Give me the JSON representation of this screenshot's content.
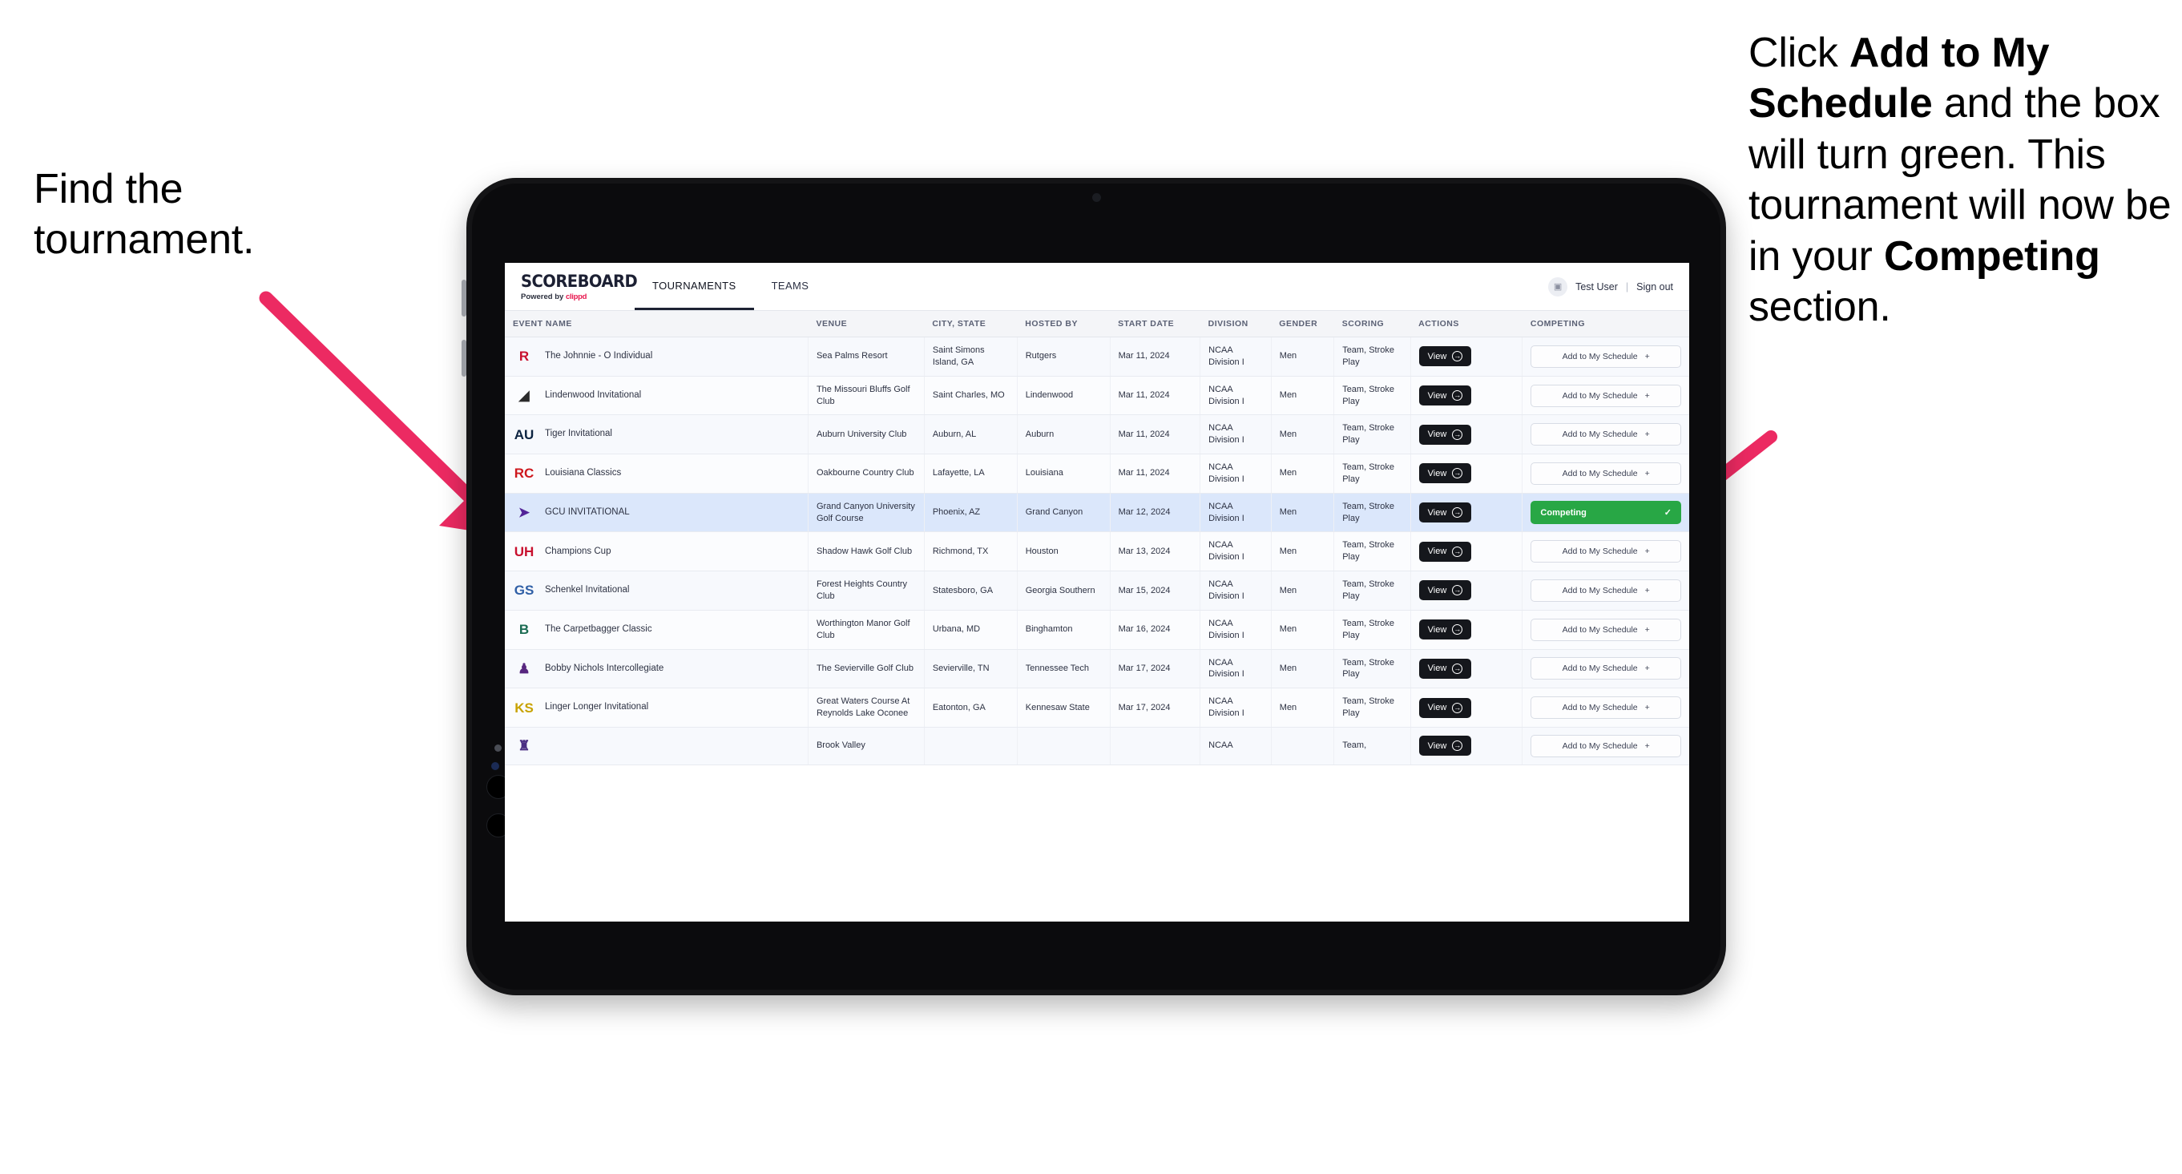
{
  "annotations": {
    "left": "Find the tournament.",
    "right_parts": [
      {
        "t": "Click ",
        "b": false
      },
      {
        "t": "Add to My Schedule",
        "b": true
      },
      {
        "t": " and the box will turn green. This tournament will now be in your ",
        "b": false
      },
      {
        "t": "Competing",
        "b": true
      },
      {
        "t": " section.",
        "b": false
      }
    ],
    "arrow_color": "#ec2a62"
  },
  "app": {
    "brand_title": "SCOREBOARD",
    "brand_sub_prefix": "Powered by ",
    "brand_sub_name": "clippd",
    "nav": [
      {
        "label": "TOURNAMENTS",
        "active": true
      },
      {
        "label": "TEAMS",
        "active": false
      }
    ],
    "user": {
      "avatar_icon": "user-avatar-icon",
      "name": "Test User",
      "separator": "|",
      "signout": "Sign out"
    }
  },
  "table": {
    "columns": [
      "EVENT NAME",
      "VENUE",
      "CITY, STATE",
      "HOSTED BY",
      "START DATE",
      "DIVISION",
      "GENDER",
      "SCORING",
      "ACTIONS",
      "COMPETING"
    ],
    "view_label": "View",
    "add_label": "Add to My Schedule",
    "add_plus": "+",
    "competing_label": "Competing",
    "competing_check": "✓",
    "rows": [
      {
        "logo_text": "R",
        "logo_color": "#c8102e",
        "logo_bg": "transparent",
        "event": "The Johnnie - O Individual",
        "venue": "Sea Palms Resort",
        "city": "Saint Simons Island, GA",
        "host": "Rutgers",
        "date": "Mar 11, 2024",
        "division": "NCAA Division I",
        "gender": "Men",
        "scoring": "Team, Stroke Play",
        "competing": false
      },
      {
        "logo_text": "◢",
        "logo_color": "#2b2b2b",
        "logo_bg": "transparent",
        "event": "Lindenwood Invitational",
        "venue": "The Missouri Bluffs Golf Club",
        "city": "Saint Charles, MO",
        "host": "Lindenwood",
        "date": "Mar 11, 2024",
        "division": "NCAA Division I",
        "gender": "Men",
        "scoring": "Team, Stroke Play",
        "competing": false
      },
      {
        "logo_text": "AU",
        "logo_color": "#0c2340",
        "logo_bg": "transparent",
        "event": "Tiger Invitational",
        "venue": "Auburn University Club",
        "city": "Auburn, AL",
        "host": "Auburn",
        "date": "Mar 11, 2024",
        "division": "NCAA Division I",
        "gender": "Men",
        "scoring": "Team, Stroke Play",
        "competing": false
      },
      {
        "logo_text": "RC",
        "logo_color": "#ce181e",
        "logo_bg": "transparent",
        "event": "Louisiana Classics",
        "venue": "Oakbourne Country Club",
        "city": "Lafayette, LA",
        "host": "Louisiana",
        "date": "Mar 11, 2024",
        "division": "NCAA Division I",
        "gender": "Men",
        "scoring": "Team, Stroke Play",
        "competing": false
      },
      {
        "logo_text": "➤",
        "logo_color": "#522398",
        "logo_bg": "transparent",
        "event": "GCU INVITATIONAL",
        "venue": "Grand Canyon University Golf Course",
        "city": "Phoenix, AZ",
        "host": "Grand Canyon",
        "date": "Mar 12, 2024",
        "division": "NCAA Division I",
        "gender": "Men",
        "scoring": "Team, Stroke Play",
        "competing": true
      },
      {
        "logo_text": "UH",
        "logo_color": "#c8102e",
        "logo_bg": "transparent",
        "event": "Champions Cup",
        "venue": "Shadow Hawk Golf Club",
        "city": "Richmond, TX",
        "host": "Houston",
        "date": "Mar 13, 2024",
        "division": "NCAA Division I",
        "gender": "Men",
        "scoring": "Team, Stroke Play",
        "competing": false
      },
      {
        "logo_text": "GS",
        "logo_color": "#2f5fa6",
        "logo_bg": "transparent",
        "event": "Schenkel Invitational",
        "venue": "Forest Heights Country Club",
        "city": "Statesboro, GA",
        "host": "Georgia Southern",
        "date": "Mar 15, 2024",
        "division": "NCAA Division I",
        "gender": "Men",
        "scoring": "Team, Stroke Play",
        "competing": false
      },
      {
        "logo_text": "B",
        "logo_color": "#1a6b52",
        "logo_bg": "transparent",
        "event": "The Carpetbagger Classic",
        "venue": "Worthington Manor Golf Club",
        "city": "Urbana, MD",
        "host": "Binghamton",
        "date": "Mar 16, 2024",
        "division": "NCAA Division I",
        "gender": "Men",
        "scoring": "Team, Stroke Play",
        "competing": false
      },
      {
        "logo_text": "♟",
        "logo_color": "#57267f",
        "logo_bg": "transparent",
        "event": "Bobby Nichols Intercollegiate",
        "venue": "The Sevierville Golf Club",
        "city": "Sevierville, TN",
        "host": "Tennessee Tech",
        "date": "Mar 17, 2024",
        "division": "NCAA Division I",
        "gender": "Men",
        "scoring": "Team, Stroke Play",
        "competing": false
      },
      {
        "logo_text": "KS",
        "logo_color": "#c8a200",
        "logo_bg": "transparent",
        "event": "Linger Longer Invitational",
        "venue": "Great Waters Course At Reynolds Lake Oconee",
        "city": "Eatonton, GA",
        "host": "Kennesaw State",
        "date": "Mar 17, 2024",
        "division": "NCAA Division I",
        "gender": "Men",
        "scoring": "Team, Stroke Play",
        "competing": false
      },
      {
        "logo_text": "♜",
        "logo_color": "#4b2e83",
        "logo_bg": "transparent",
        "event": "",
        "venue": "Brook Valley",
        "city": "",
        "host": "",
        "date": "",
        "division": "NCAA",
        "gender": "",
        "scoring": "Team,",
        "competing": false
      }
    ]
  }
}
